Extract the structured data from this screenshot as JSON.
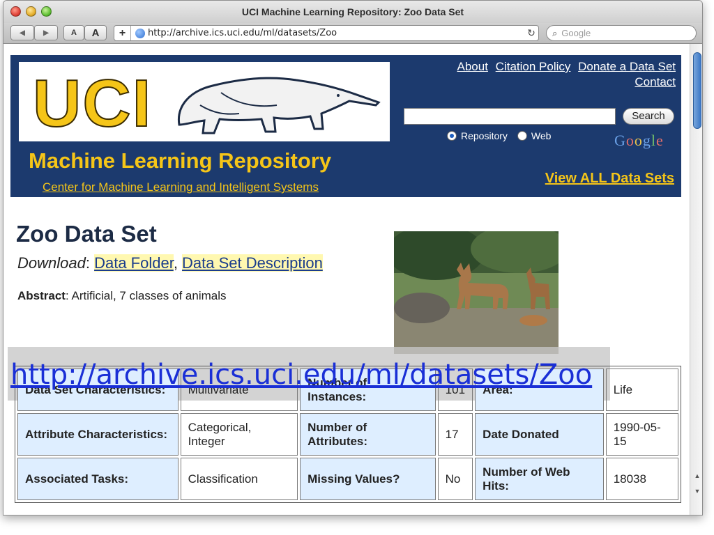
{
  "window": {
    "title": "UCI Machine Learning Repository: Zoo Data Set"
  },
  "toolbar": {
    "back": "◀",
    "forward": "▶",
    "font_small": "A",
    "font_large": "A",
    "add": "+",
    "url": "http://archive.ics.uci.edu/ml/datasets/Zoo",
    "reload": "↻",
    "search_placeholder": "Google"
  },
  "header": {
    "logo_text": "UCI",
    "title": "Machine Learning Repository",
    "subtitle": "Center for Machine Learning and Intelligent Systems",
    "links": [
      "About",
      "Citation Policy",
      "Donate a Data Set",
      "Contact"
    ],
    "search_button": "Search",
    "radio_repository": "Repository",
    "radio_web": "Web",
    "view_all": "View ALL Data Sets"
  },
  "dataset": {
    "title": "Zoo Data Set",
    "download_label": "Download",
    "data_folder": "Data Folder",
    "description": "Data Set Description",
    "abstract_label": "Abstract",
    "abstract_text": ": Artificial, 7 classes of animals"
  },
  "overlay": {
    "url": "http://archive.ics.uci.edu/ml/datasets/Zoo"
  },
  "table": {
    "rows": [
      [
        "Data Set Characteristics:",
        "Multivariate",
        "Number of Instances:",
        "101",
        "Area:",
        "Life"
      ],
      [
        "Attribute Characteristics:",
        "Categorical, Integer",
        "Number of Attributes:",
        "17",
        "Date Donated",
        "1990-05-15"
      ],
      [
        "Associated Tasks:",
        "Classification",
        "Missing Values?",
        "No",
        "Number of Web Hits:",
        "18038"
      ]
    ]
  },
  "colors": {
    "banner": "#1c3a6e",
    "accent": "#f5c518",
    "header_cell": "#deeeff"
  }
}
